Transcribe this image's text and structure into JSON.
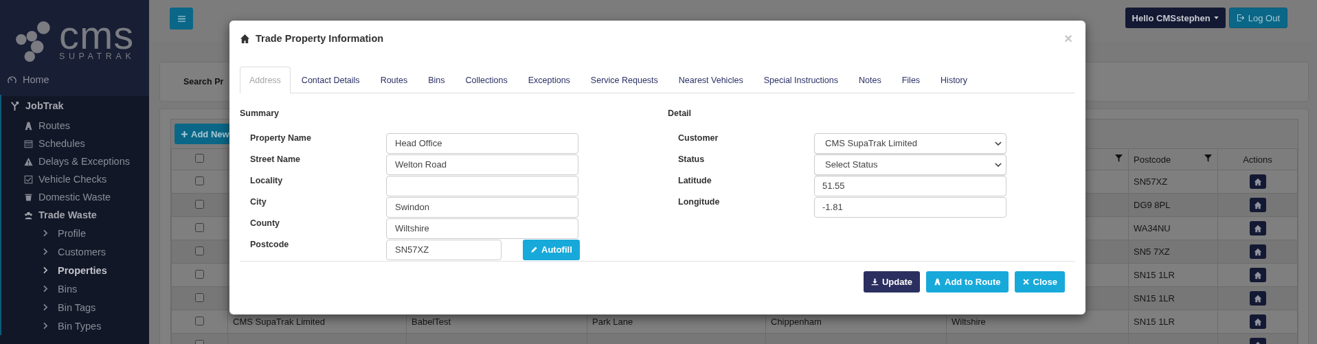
{
  "sidebar": {
    "logo": {
      "wordmark": "cms",
      "tagline": "SUPATRAK"
    },
    "items": [
      {
        "label": "Home",
        "selected": false
      },
      {
        "label": "JobTrak",
        "selected": false,
        "expanded": true,
        "children": [
          {
            "label": "Routes",
            "selected": false
          },
          {
            "label": "Schedules",
            "selected": false
          },
          {
            "label": "Delays & Exceptions",
            "selected": false
          },
          {
            "label": "Vehicle Checks",
            "selected": false
          },
          {
            "label": "Domestic Waste",
            "selected": false
          },
          {
            "label": "Trade Waste",
            "selected": false,
            "expanded": true,
            "children": [
              {
                "label": "Profile",
                "selected": false
              },
              {
                "label": "Customers",
                "selected": false
              },
              {
                "label": "Properties",
                "selected": true
              },
              {
                "label": "Bins",
                "selected": false
              },
              {
                "label": "Bin Tags",
                "selected": false
              },
              {
                "label": "Bin Types",
                "selected": false
              }
            ]
          }
        ]
      }
    ]
  },
  "topbar": {
    "user_menu": "Hello CMSstephen",
    "logout": "Log Out"
  },
  "page": {
    "search_label": "Search Pr",
    "add_button": "Add New",
    "table": {
      "select_all_checked": false,
      "header": {
        "column_6": {
          "filter": true
        },
        "postcode": {
          "label": "Postcode",
          "filter": true
        },
        "actions": {
          "label": "Actions"
        }
      },
      "rows": [
        {
          "checked": false,
          "postcode": "SN57XZ"
        },
        {
          "checked": false,
          "postcode": "DG9 8PL"
        },
        {
          "checked": false,
          "postcode": "WA34NU"
        },
        {
          "checked": false,
          "postcode": "SN5 7XZ"
        },
        {
          "checked": false,
          "postcode": "SN15 1LR"
        },
        {
          "checked": false,
          "postcode": "SN15 1LR"
        },
        {
          "checked": false,
          "column_2": "CMS SupaTrak Limited",
          "column_3": "BabelTest",
          "column_4": "Park Lane",
          "column_5": "Chippenham",
          "column_6": "Wiltshire",
          "postcode": "SN15 1LR"
        },
        {
          "checked": false
        }
      ]
    }
  },
  "modal": {
    "title": "Trade Property Information",
    "close": "×",
    "tabs": [
      {
        "label": "Address",
        "selected": true
      },
      {
        "label": "Contact Details",
        "selected": false
      },
      {
        "label": "Routes",
        "selected": false
      },
      {
        "label": "Bins",
        "selected": false
      },
      {
        "label": "Collections",
        "selected": false
      },
      {
        "label": "Exceptions",
        "selected": false
      },
      {
        "label": "Service Requests",
        "selected": false
      },
      {
        "label": "Nearest Vehicles",
        "selected": false
      },
      {
        "label": "Special Instructions",
        "selected": false
      },
      {
        "label": "Notes",
        "selected": false
      },
      {
        "label": "Files",
        "selected": false
      },
      {
        "label": "History",
        "selected": false
      }
    ],
    "summary": {
      "heading": "Summary",
      "autofill": "Autofill",
      "fields": [
        {
          "label": "Property Name",
          "kind": "text",
          "value": "Head Office"
        },
        {
          "label": "Street Name",
          "kind": "text",
          "value": "Welton Road"
        },
        {
          "label": "Locality",
          "kind": "text"
        },
        {
          "label": "City",
          "kind": "text",
          "value": "Swindon"
        },
        {
          "label": "County",
          "kind": "text",
          "value": "Wiltshire"
        },
        {
          "label": "Postcode",
          "kind": "postcode",
          "value": "SN57XZ"
        }
      ]
    },
    "detail": {
      "heading": "Detail",
      "fields": [
        {
          "label": "Customer",
          "kind": "select",
          "value": "CMS SupaTrak Limited"
        },
        {
          "label": "Status",
          "kind": "select",
          "value": "Select Status"
        },
        {
          "label": "Latitude",
          "kind": "text",
          "value": "51.55"
        },
        {
          "label": "Longitude",
          "kind": "text",
          "value": "-1.81"
        }
      ]
    },
    "buttons": [
      {
        "label": "Update",
        "kind": "primary"
      },
      {
        "label": "Add to Route",
        "kind": "info"
      },
      {
        "label": "Close",
        "kind": "info"
      }
    ]
  }
}
